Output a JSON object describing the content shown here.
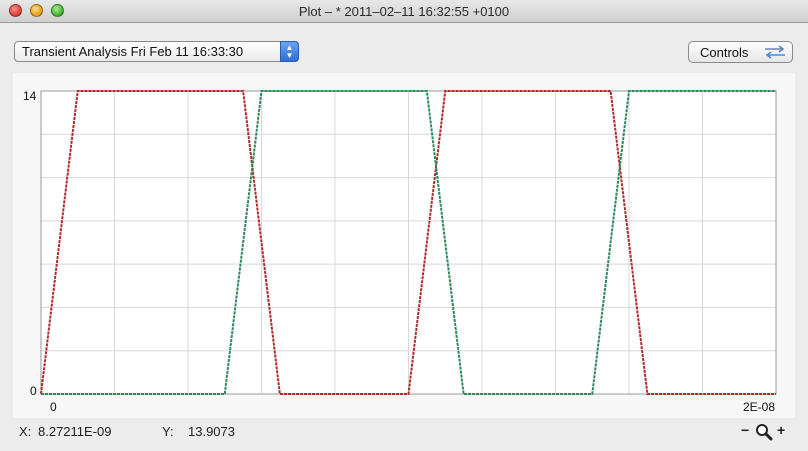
{
  "window": {
    "title": "Plot – * 2011–02–11 16:32:55 +0100"
  },
  "toolbar": {
    "analysis_select": "Transient Analysis  Fri Feb 11 16:33:30",
    "controls_label": "Controls"
  },
  "status": {
    "x_label": "X:",
    "x_value": "8.27211E-09",
    "y_label": "Y:",
    "y_value": "13.9073",
    "zoom_out": "−",
    "zoom_in": "+"
  },
  "chart_data": {
    "type": "line",
    "title": "",
    "xlabel": "",
    "ylabel": "",
    "xlim": [
      0,
      2e-08
    ],
    "ylim": [
      0,
      14
    ],
    "x_tick_labels": [
      "0",
      "2E-08"
    ],
    "y_tick_labels": [
      "0",
      "14"
    ],
    "grid": true,
    "series": [
      {
        "color": "#b02a2a",
        "x": [
          0,
          1e-09,
          5.5e-09,
          6.5e-09,
          1e-08,
          1.1e-08,
          1.55e-08,
          1.65e-08,
          2e-08
        ],
        "y": [
          0,
          14,
          14,
          0,
          0,
          14,
          14,
          0,
          0
        ]
      },
      {
        "color": "#2a8a5a",
        "x": [
          0,
          5e-09,
          6e-09,
          1.05e-08,
          1.15e-08,
          1.5e-08,
          1.6e-08,
          2e-08
        ],
        "y": [
          0,
          0,
          14,
          14,
          0,
          0,
          14,
          14
        ]
      }
    ]
  },
  "icons": {
    "controls": "swap-arrows-icon",
    "zoom": "magnifier-icon"
  }
}
